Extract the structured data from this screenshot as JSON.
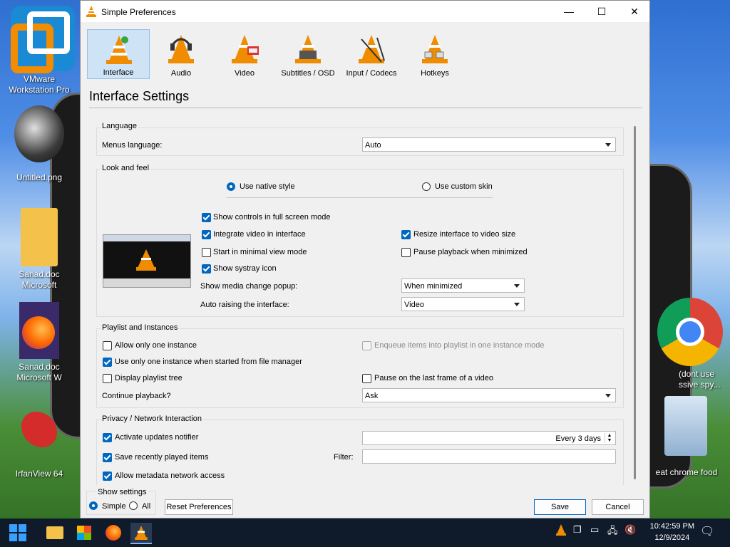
{
  "desktop": {
    "icons": [
      {
        "label": "VMware Workstation Pro"
      },
      {
        "label": "Untitled.png"
      },
      {
        "label": "Sanad.doc Microsoft"
      },
      {
        "label": "Sanad.doc Microsoft W"
      },
      {
        "label": "IrfanView 64"
      },
      {
        "label": "(dont use ssive spy..."
      },
      {
        "label": "eat chrome food"
      }
    ]
  },
  "window": {
    "title": "Simple Preferences",
    "controls": {
      "minimize": "—",
      "maximize": "☐",
      "close": "✕"
    }
  },
  "categories": [
    {
      "label": "Interface",
      "selected": true
    },
    {
      "label": "Audio"
    },
    {
      "label": "Video"
    },
    {
      "label": "Subtitles / OSD"
    },
    {
      "label": "Input / Codecs"
    },
    {
      "label": "Hotkeys"
    }
  ],
  "page_title": "Interface Settings",
  "language": {
    "group_title": "Language",
    "menus_language_label": "Menus language:",
    "menus_language_value": "Auto"
  },
  "look_and_feel": {
    "group_title": "Look and feel",
    "native_style": "Use native style",
    "custom_skin": "Use custom skin",
    "fullscreen_controls": "Show controls in full screen mode",
    "integrate_video": "Integrate video in interface",
    "resize_interface": "Resize interface to video size",
    "minimal_view": "Start in minimal view mode",
    "pause_minimized": "Pause playback when minimized",
    "systray": "Show systray icon",
    "media_popup_label": "Show media change popup:",
    "media_popup_value": "When minimized",
    "auto_raise_label": "Auto raising the interface:",
    "auto_raise_value": "Video"
  },
  "playlist": {
    "group_title": "Playlist and Instances",
    "one_instance": "Allow only one instance",
    "enqueue": "Enqueue items into playlist in one instance mode",
    "file_manager": "Use only one instance when started from file manager",
    "playlist_tree": "Display playlist tree",
    "pause_last_frame": "Pause on the last frame of a video",
    "continue_label": "Continue playback?",
    "continue_value": "Ask"
  },
  "privacy": {
    "group_title": "Privacy / Network Interaction",
    "updates": "Activate updates notifier",
    "updates_value": "Every 3 days",
    "recent": "Save recently played items",
    "filter_label": "Filter:",
    "filter_value": "",
    "metadata": "Allow metadata network access"
  },
  "footer": {
    "show_settings": "Show settings",
    "simple": "Simple",
    "all": "All",
    "reset": "Reset Preferences",
    "save": "Save",
    "cancel": "Cancel"
  },
  "taskbar": {
    "time": "10:42:59 PM",
    "date": "12/9/2024"
  },
  "colors": {
    "accent": "#0067c0",
    "vlc_orange": "#f08c00",
    "selected_tab_bg": "#cfe3f7"
  }
}
